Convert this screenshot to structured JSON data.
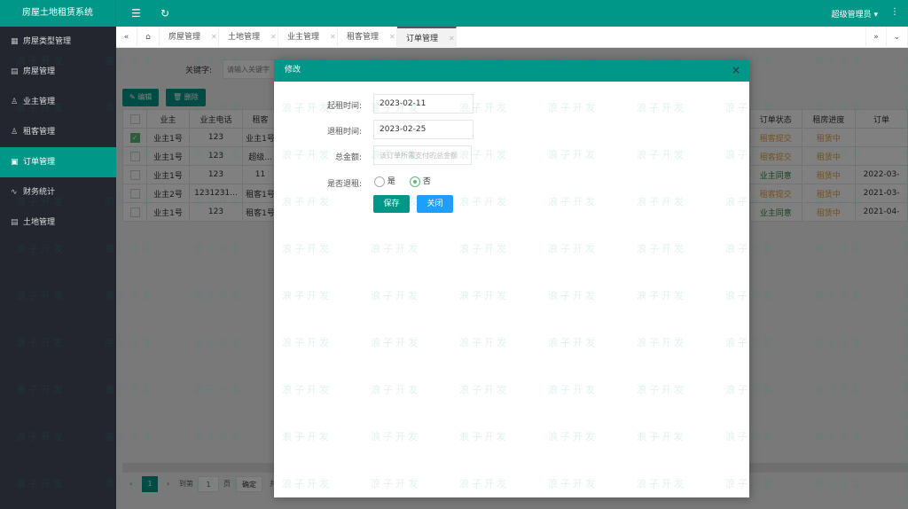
{
  "app_title": "房屋土地租赁系统",
  "header": {
    "user": "超级管理员"
  },
  "sidebar": {
    "items": [
      {
        "label": "房屋类型管理",
        "icon": "grid-icon"
      },
      {
        "label": "房屋管理",
        "icon": "file-icon"
      },
      {
        "label": "业主管理",
        "icon": "user-icon"
      },
      {
        "label": "租客管理",
        "icon": "user-icon"
      },
      {
        "label": "订单管理",
        "icon": "calendar-icon",
        "active": true
      },
      {
        "label": "财务统计",
        "icon": "chart-icon"
      },
      {
        "label": "土地管理",
        "icon": "file-icon"
      }
    ]
  },
  "tabs": [
    "房屋管理",
    "土地管理",
    "业主管理",
    "租客管理",
    "订单管理"
  ],
  "search": {
    "label": "关键字:",
    "placeholder": "请输入关键字"
  },
  "toolbar": {
    "edit": "编辑",
    "delete": "删除"
  },
  "table": {
    "headers_left": [
      "业主",
      "业主电话",
      "租客"
    ],
    "headers_right": [
      "订单状态",
      "租房进度",
      "订单"
    ],
    "rows": [
      {
        "checked": true,
        "owner": "业主1号",
        "phone": "123",
        "tenant": "业主1号",
        "status": "租客提交",
        "progress": "租赁中",
        "date": ""
      },
      {
        "checked": false,
        "owner": "业主1号",
        "phone": "123",
        "tenant": "超级...",
        "status": "租客提交",
        "progress": "租赁中",
        "date": ""
      },
      {
        "checked": false,
        "owner": "业主1号",
        "phone": "123",
        "tenant": "11",
        "status": "业主同意",
        "progress": "租赁中",
        "date": "2022-03-"
      },
      {
        "checked": false,
        "owner": "业主2号",
        "phone": "1231231...",
        "tenant": "租客1号",
        "status": "租客提交",
        "progress": "租赁中",
        "date": "2021-03-"
      },
      {
        "checked": false,
        "owner": "业主1号",
        "phone": "123",
        "tenant": "租客1号",
        "status": "业主同意",
        "progress": "租赁中",
        "date": "2021-04-"
      }
    ]
  },
  "pager": {
    "page": "1",
    "goto": "到第",
    "input": "1",
    "unit": "页",
    "confirm": "确定",
    "total": "共"
  },
  "modal": {
    "title": "修改",
    "start_label": "起租时间:",
    "start_value": "2023-02-11",
    "end_label": "退租时间:",
    "end_value": "2023-02-25",
    "amount_label": "总金额:",
    "amount_placeholder": "该订单所需支付的总金额",
    "refund_label": "是否退租:",
    "yes": "是",
    "no": "否",
    "selected": "否",
    "save": "保存",
    "close": "关闭"
  },
  "watermark": "浪子开发",
  "colors": {
    "primary": "#009688",
    "sidebar": "#23262e",
    "blue": "#1e9fff",
    "orange": "#e6a23c",
    "green": "#2f8a3f"
  }
}
